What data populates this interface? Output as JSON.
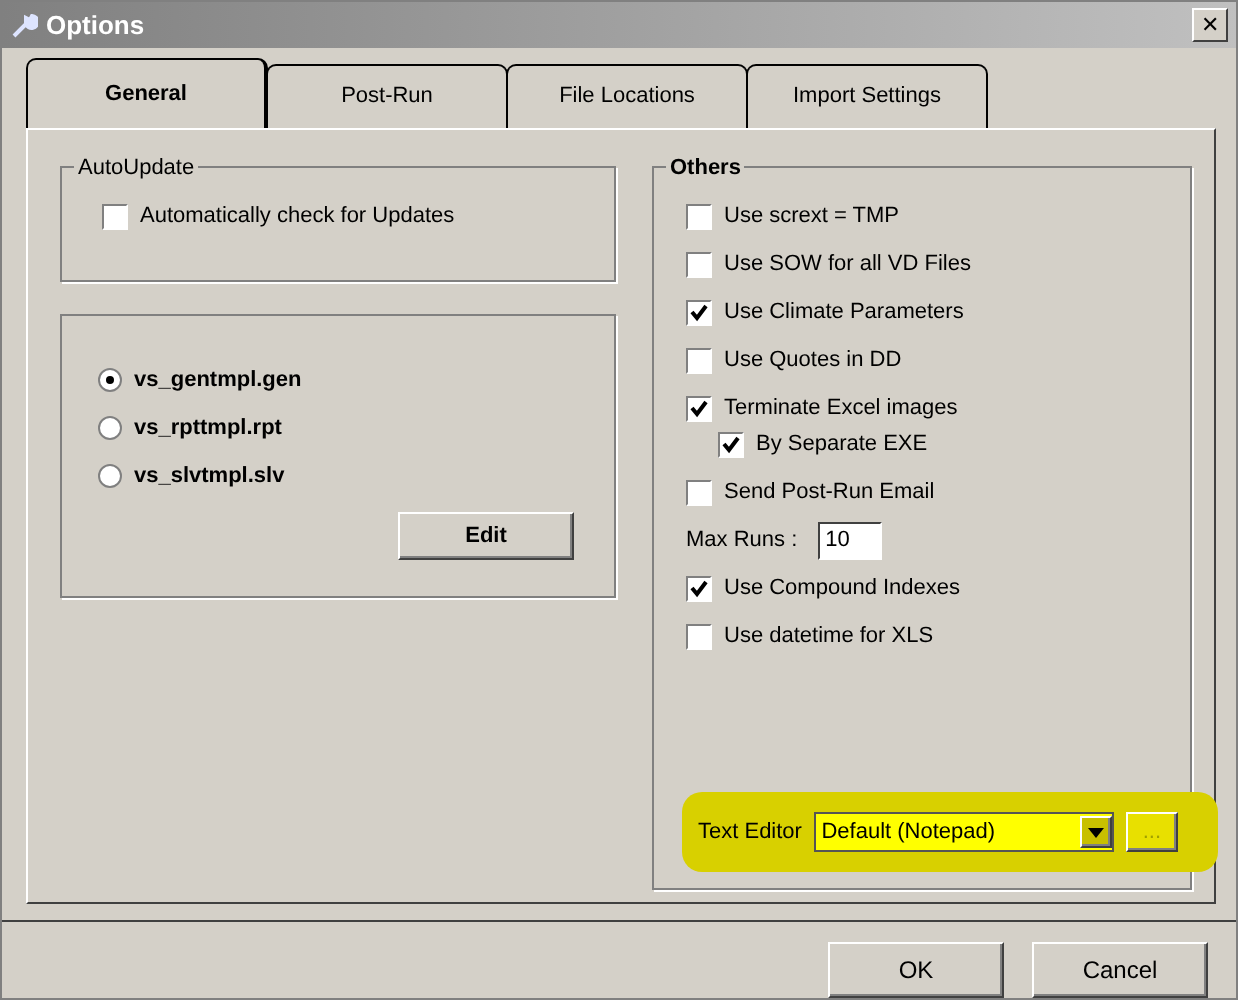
{
  "window": {
    "title": "Options",
    "close": "✕"
  },
  "tabs": [
    {
      "label": "General",
      "selected": true
    },
    {
      "label": "Post-Run",
      "selected": false
    },
    {
      "label": "File Locations",
      "selected": false
    },
    {
      "label": "Import Settings",
      "selected": false
    }
  ],
  "autoupdate": {
    "title": "AutoUpdate",
    "label": "Automatically check for Updates",
    "checked": false
  },
  "templates": {
    "options": [
      {
        "label": "vs_gentmpl.gen",
        "selected": true
      },
      {
        "label": "vs_rpttmpl.rpt",
        "selected": false
      },
      {
        "label": "vs_slvtmpl.slv",
        "selected": false
      }
    ],
    "button": "Edit"
  },
  "others": {
    "title": "Others",
    "items": [
      {
        "kind": "check",
        "label": "Use scrext = TMP",
        "checked": false
      },
      {
        "kind": "check",
        "label": "Use SOW for all VD Files",
        "checked": false
      },
      {
        "kind": "check",
        "label": "Use Climate Parameters",
        "checked": true
      },
      {
        "kind": "check",
        "label": "Use Quotes in DD",
        "checked": false
      },
      {
        "kind": "check",
        "label": "Terminate Excel images",
        "checked": true,
        "children": [
          {
            "kind": "check",
            "label": "By Separate EXE",
            "checked": true
          }
        ]
      },
      {
        "kind": "check",
        "label": "Send Post-Run Email",
        "checked": false
      },
      {
        "kind": "number",
        "label": "Max Runs :",
        "value": "10"
      },
      {
        "kind": "check",
        "label": "Use Compound Indexes",
        "checked": true
      },
      {
        "kind": "check",
        "label": "Use datetime for XLS",
        "checked": false
      }
    ],
    "text_editor": {
      "label": "Text Editor",
      "value": "Default (Notepad)",
      "browse": "...",
      "browse_disabled": true
    }
  },
  "buttons": [
    "OK",
    "Cancel"
  ]
}
